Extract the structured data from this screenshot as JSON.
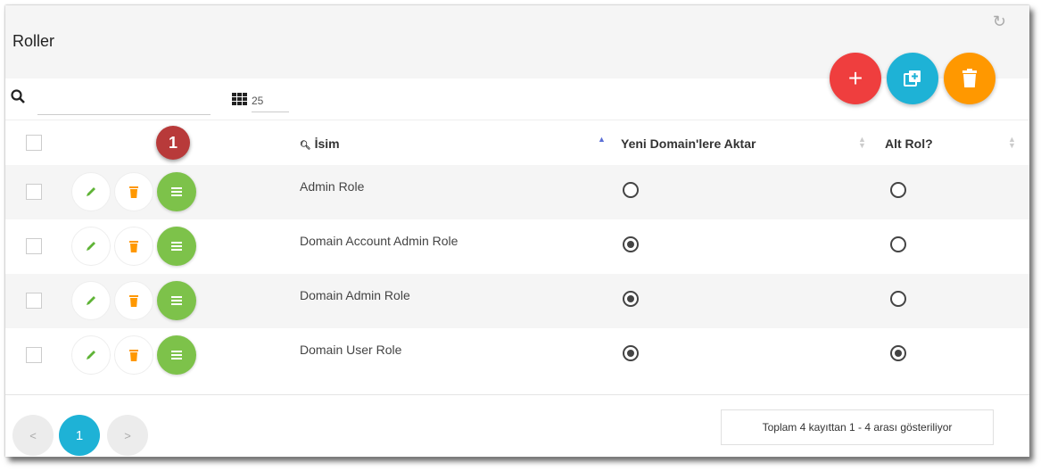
{
  "header": {
    "title": "Roller",
    "refresh_icon": "refresh-icon"
  },
  "actions": {
    "add_label": "+",
    "copy_icon": "copy-add-icon",
    "delete_icon": "trash-icon"
  },
  "search": {
    "value": "",
    "placeholder": ""
  },
  "page_size": "25",
  "columns": {
    "name": "İsim",
    "transfer": "Yeni Domain'lere Aktar",
    "subrole": "Alt Rol?"
  },
  "badge": "1",
  "rows": [
    {
      "name": "Admin Role",
      "transfer": false,
      "subrole": false
    },
    {
      "name": "Domain Account Admin Role",
      "transfer": true,
      "subrole": false
    },
    {
      "name": "Domain Admin Role",
      "transfer": true,
      "subrole": false
    },
    {
      "name": "Domain User Role",
      "transfer": true,
      "subrole": true
    }
  ],
  "pagination": {
    "prev": "<",
    "current": "1",
    "next": ">"
  },
  "footer_info": "Toplam 4 kayıttan 1 - 4 arası gösteriliyor",
  "colors": {
    "red": "#ef3e3e",
    "cyan": "#1eb2d6",
    "orange": "#ff9800",
    "green": "#7dc24a"
  }
}
